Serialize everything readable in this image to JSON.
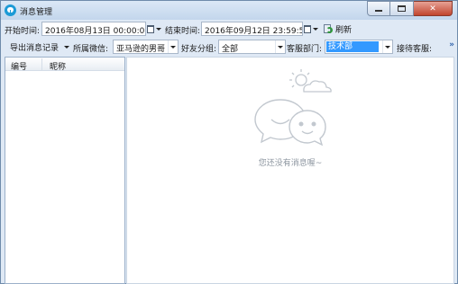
{
  "window": {
    "title": "消息管理"
  },
  "toolbar_row1": {
    "start_label": "开始时间:",
    "start_value": "2016年08月13日  00:00:00",
    "end_label": "结束时间:",
    "end_value": "2016年09月12日  23:59:59",
    "refresh_label": "刷新"
  },
  "toolbar_row2": {
    "export_label": "导出消息记录",
    "wechat_label": "所属微信:",
    "wechat_value": "亚马逊的男哥",
    "friend_group_label": "好友分组:",
    "friend_group_value": "全部",
    "department_label": "客服部门:",
    "department_value": "技术部",
    "agent_label": "接待客服:",
    "more_glyph": "»"
  },
  "list": {
    "columns": [
      "编号",
      "昵称"
    ]
  },
  "empty_state": {
    "message": "您还没有消息喔~"
  },
  "colors": {
    "accent": "#1c9ad6",
    "selection": "#3399ff",
    "empty_art": "#c2c8cf"
  }
}
